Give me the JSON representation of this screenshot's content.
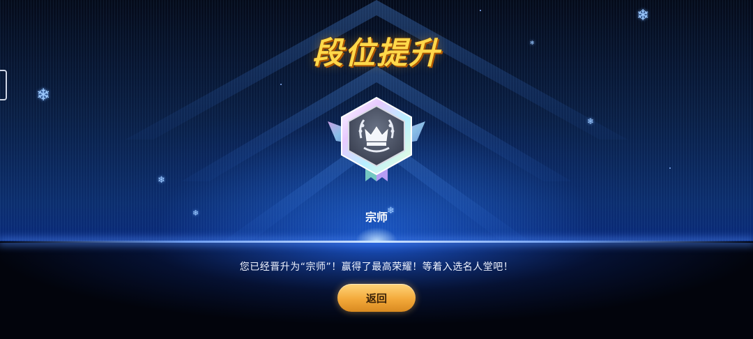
{
  "screen": {
    "title": "段位提升",
    "rank_name": "宗师",
    "message": "您已经晋升为“宗师”！赢得了最高荣耀！等着入选名人堂吧！",
    "return_button": "返回"
  },
  "icons": {
    "emblem": "crown-rank-badge-icon",
    "snowflake": "snowflake-icon",
    "side_handle": "side-tab-handle-icon"
  },
  "colors": {
    "title": "#ffd84a",
    "button": "#f3a93a",
    "background": "#0a2a78",
    "horizon": "#cfe3ff"
  }
}
